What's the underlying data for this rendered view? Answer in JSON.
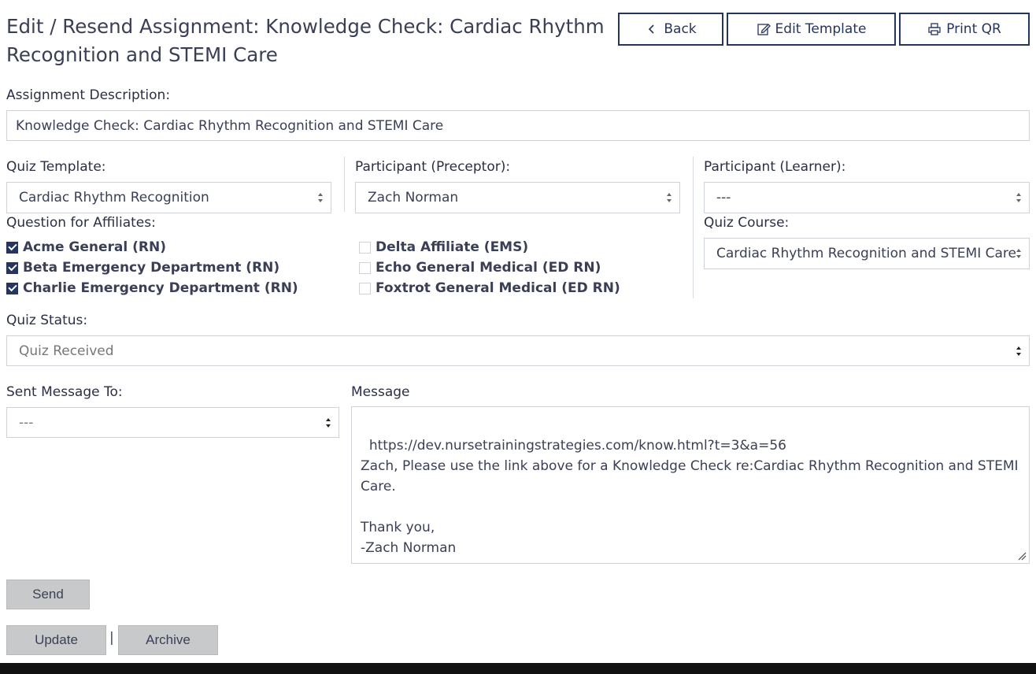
{
  "header": {
    "title": "Edit / Resend Assignment: Knowledge Check: Cardiac Rhythm Recognition and STEMI Care",
    "back_label": "Back",
    "edit_template_label": "Edit Template",
    "print_qr_label": "Print QR"
  },
  "description": {
    "label": "Assignment Description:",
    "value": "Knowledge Check: Cardiac Rhythm Recognition and STEMI Care"
  },
  "quiz_template": {
    "label": "Quiz Template:",
    "value": "Cardiac Rhythm Recognition"
  },
  "preceptor": {
    "label": "Participant (Preceptor):",
    "value": "Zach Norman"
  },
  "learner": {
    "label": "Participant (Learner):",
    "value": "---"
  },
  "quiz_course": {
    "label": "Quiz Course:",
    "value": "Cardiac Rhythm Recognition and STEMI Care"
  },
  "affiliates": {
    "label": "Question for Affiliates:",
    "items": [
      {
        "label": "Acme General (RN)",
        "checked": true
      },
      {
        "label": "Beta Emergency Department (RN)",
        "checked": true
      },
      {
        "label": "Charlie Emergency Department (RN)",
        "checked": true
      },
      {
        "label": "Delta Affiliate (EMS)",
        "checked": false
      },
      {
        "label": "Echo General Medical (ED RN)",
        "checked": false
      },
      {
        "label": "Foxtrot General Medical (ED RN)",
        "checked": false
      }
    ]
  },
  "quiz_status": {
    "label": "Quiz Status:",
    "value": "Quiz Received"
  },
  "sent_to": {
    "label": "Sent Message To:",
    "value": "---"
  },
  "message": {
    "label": "Message",
    "value": "https://dev.nursetrainingstrategies.com/know.html?t=3&a=56\nZach, Please use the link above for a Knowledge Check re:Cardiac Rhythm Recognition and STEMI Care.\n\nThank you,\n-Zach Norman"
  },
  "actions": {
    "send_label": "Send",
    "update_label": "Update",
    "separator": "|",
    "archive_label": "Archive"
  },
  "colors": {
    "accent": "#26355d",
    "button_grey": "#c8c9cb",
    "footer": "#111111"
  }
}
